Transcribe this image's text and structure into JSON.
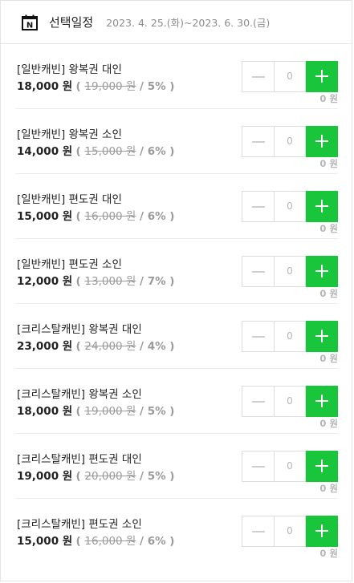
{
  "header": {
    "icon": "calendar-icon",
    "icon_letter": "N",
    "title": "선택일정",
    "date_range": "2023. 4. 25.(화)~2023. 6. 30.(금)"
  },
  "colors": {
    "accent_green": "#19c63b",
    "muted_text": "#9a9a9a"
  },
  "items": [
    {
      "name": "[일반캐빈] 왕복권 대인",
      "price": "18,000 원",
      "orig_price": "19,000 원",
      "discount": "5%",
      "qty": "0",
      "subtotal": "0 원"
    },
    {
      "name": "[일반캐빈] 왕복권 소인",
      "price": "14,000 원",
      "orig_price": "15,000 원",
      "discount": "6%",
      "qty": "0",
      "subtotal": "0 원"
    },
    {
      "name": "[일반캐빈] 편도권 대인",
      "price": "15,000 원",
      "orig_price": "16,000 원",
      "discount": "6%",
      "qty": "0",
      "subtotal": "0 원"
    },
    {
      "name": "[일반캐빈] 편도권 소인",
      "price": "12,000 원",
      "orig_price": "13,000 원",
      "discount": "7%",
      "qty": "0",
      "subtotal": "0 원"
    },
    {
      "name": "[크리스탈캐빈] 왕복권 대인",
      "price": "23,000 원",
      "orig_price": "24,000 원",
      "discount": "4%",
      "qty": "0",
      "subtotal": "0 원"
    },
    {
      "name": "[크리스탈캐빈] 왕복권 소인",
      "price": "18,000 원",
      "orig_price": "19,000 원",
      "discount": "5%",
      "qty": "0",
      "subtotal": "0 원"
    },
    {
      "name": "[크리스탈캐빈] 편도권 대인",
      "price": "19,000 원",
      "orig_price": "20,000 원",
      "discount": "5%",
      "qty": "0",
      "subtotal": "0 원"
    },
    {
      "name": "[크리스탈캐빈] 편도권 소인",
      "price": "15,000 원",
      "orig_price": "16,000 원",
      "discount": "6%",
      "qty": "0",
      "subtotal": "0 원"
    }
  ]
}
